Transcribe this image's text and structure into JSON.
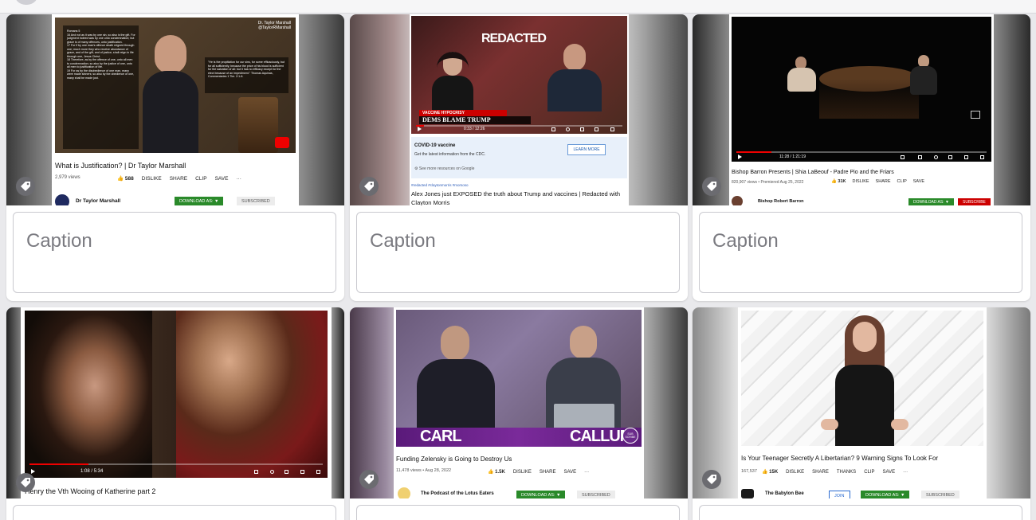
{
  "caption_placeholder": "Caption",
  "cards": [
    {
      "title": "What is Justification? | Dr Taylor Marshall",
      "views": "2,979 views",
      "likes": "588",
      "dislike": "DISLIKE",
      "share": "SHARE",
      "clip": "CLIP",
      "save": "SAVE",
      "channel": "Dr Taylor Marshall",
      "download": "DOWNLOAD AS: ▼",
      "subscribed": "SUBSCRIBED",
      "handle_name": "Dr. Taylor Marshall",
      "handle": "@TaylorRMarshall",
      "left_text": "Romans 5\n16 And not as it was by one sin, so also is the gift. For judgment indeed was by one unto condemnation; but grace is of many offences, unto justification.\n17 For if by one man's offence death reigned through one; much more they who receive abundance of grace, and of the gift, and of justice, shall reign in life through one, Jesus Christ.\n18 Therefore, as by the offence of one, unto all men to condemnation; so also by the justice of one, unto all men to justification of life.\n19 For as by the disobedience of one man, many were made sinners; so also by the obedience of one, many shall be made just.",
      "right_text": "\"He is the propitiation for our sins, for some efficaciously, but for all sufficiently, because the price of his blood is sufficient for the salvation of all: but it has no efficacy except for the elect because of an impediment.\" Thomas Aquinas, Commentaries 1 Tim. 2:1-6."
    },
    {
      "title": "Alex Jones just EXPOSED the truth about Trump and vaccines | Redacted with Clayton Morris",
      "hashtags": "#redacted #claytonmorris #morsoso",
      "brand": "REDACTED",
      "banner_tag": "VACCINE HYPOCRISY",
      "banner": "DEMS BLAME TRUMP",
      "time": "0:33 / 12:26",
      "info_title": "COVID-19 vaccine",
      "info_sub": "Get the latest information from the CDC.",
      "info_btn": "LEARN MORE",
      "info_more": "See more resources on Google"
    },
    {
      "title": "Bishop Barron Presents | Shia LaBeouf - Padre Pio and the Friars",
      "views": "820,907 views • Premiered Aug 25, 2022",
      "likes": "31K",
      "dislike": "DISLIKE",
      "share": "SHARE",
      "clip": "CLIP",
      "save": "SAVE",
      "channel": "Bishop Robert Barron",
      "download": "DOWNLOAD AS: ▼",
      "subscribe": "SUBSCRIBE",
      "time": "11:28 / 1:21:19"
    },
    {
      "title": "Henry the Vth Wooing of Katherine part 2",
      "time": "1:08 / 5:34"
    },
    {
      "title": "Funding Zelensky is Going to Destroy Us",
      "views": "11,478 views • Aug 28, 2022",
      "likes": "1.5K",
      "dislike": "DISLIKE",
      "share": "SHARE",
      "save": "SAVE",
      "channel": "The Podcast of the Lotus Eaters",
      "download": "DOWNLOAD AS: ▼",
      "subscribed": "SUBSCRIBED",
      "name_left": "CARL",
      "name_right": "CALLUM",
      "sub_badge": "SUB SCRIBE"
    },
    {
      "title": "Is Your Teenager Secretly A Libertarian? 9 Warning Signs To Look For",
      "views": "167,537",
      "likes": "15K",
      "dislike": "DISLIKE",
      "share": "SHARE",
      "thanks": "THANKS",
      "clip": "CLIP",
      "save": "SAVE",
      "channel": "The Babylon Bee",
      "join": "JOIN",
      "download": "DOWNLOAD AS: ▼",
      "subscribed": "SUBSCRIBED"
    }
  ],
  "colors": {
    "page_bg": "#e9e9ec",
    "tag_button": "#6b6b70",
    "download_green": "#2a8a2a",
    "subscribe_red": "#cc0000",
    "progress_red": "#e00000"
  }
}
